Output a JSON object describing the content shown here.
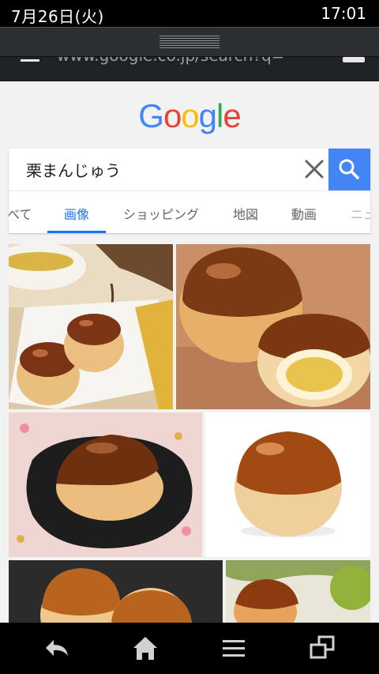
{
  "status_bar": {
    "date": "7月26日(火)",
    "time": "17:01"
  },
  "url_bar": {
    "text": "www.google.co.jp/search?q="
  },
  "logo": {
    "letters": [
      "G",
      "o",
      "o",
      "g",
      "l",
      "e"
    ]
  },
  "search": {
    "query": "栗まんじゅう"
  },
  "tabs": [
    {
      "label": "べて"
    },
    {
      "label": "画像"
    },
    {
      "label": "ショッピング"
    },
    {
      "label": "地図"
    },
    {
      "label": "動画"
    },
    {
      "label": "ニュ"
    }
  ],
  "colors": {
    "google_blue": "#4285f4",
    "google_red": "#ea4335",
    "google_yellow": "#fbbc05",
    "google_green": "#34a853",
    "active_tab": "#1a73e8"
  },
  "icons": {
    "clear": "close-icon",
    "search": "search-icon",
    "back": "back-arrow-icon",
    "home": "home-icon",
    "menu": "menu-icon",
    "windows": "windows-icon"
  }
}
